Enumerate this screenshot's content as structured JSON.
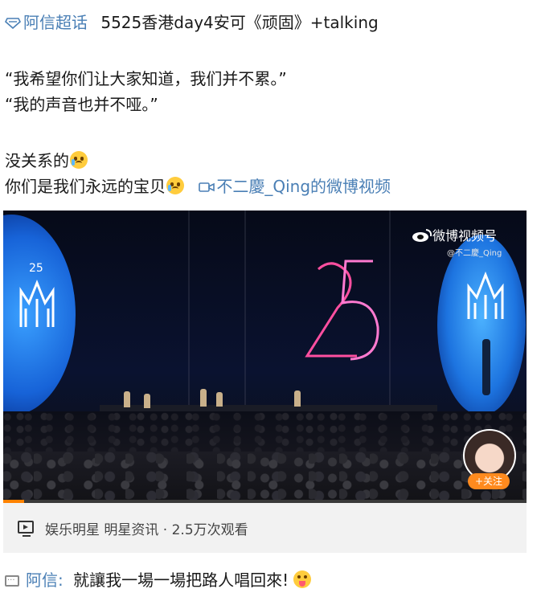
{
  "post": {
    "topic_icon": "super-topic-icon",
    "topic_label": "阿信超话",
    "title": "5525香港day4安可《顽固》+talking",
    "quote1": "“我希望你们让大家知道，我们并不累。”",
    "quote2": "“我的声音也并不哑。”",
    "line3": "没关系的",
    "line4": "你们是我们永远的宝贝",
    "video_link_icon": "video-camera-icon",
    "video_link": "不二慶_Qing的微博视频"
  },
  "video": {
    "watermark_title": "微博视频号",
    "watermark_handle": "@不二慶_Qing",
    "follow_label": "+关注",
    "progress": 0.04,
    "accent_color": "#ff8200"
  },
  "meta": {
    "icon": "video-play-icon",
    "text": "娱乐明星 明星资讯 · 2.5万次观看"
  },
  "comment": {
    "icon": "comment-icon",
    "author": "阿信",
    "separator": ":",
    "text": "就讓我一場一場把路人唱回來!"
  },
  "colors": {
    "link": "#4a7fb5",
    "meta_bg": "#f2f2f2",
    "follow_bg": "#ff8a1e"
  }
}
